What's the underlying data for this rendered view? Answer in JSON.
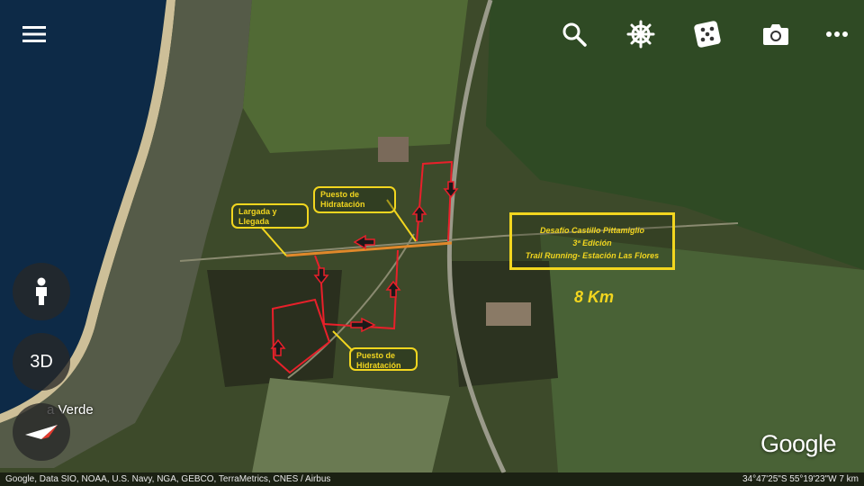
{
  "callouts": {
    "start": "Largada y Llegada",
    "hydration_top": "Puesto de Hidratación",
    "hydration_bottom": "Puesto de Hidratación"
  },
  "info": {
    "title": "Desafío Castillo Pittamiglio",
    "edition": "3ª Edición",
    "subtitle": "Trail Running- Estación Las Flores"
  },
  "distance": "8 Km",
  "town": "a Verde",
  "logo": "Google",
  "buttons": {
    "view_3d": "3D"
  },
  "footer": {
    "attribution": "Google, Data SIO, NOAA, U.S. Navy, NGA, GEBCO, TerraMetrics, CNES / Airbus",
    "coords": "34°47'25\"S 55°19'23\"W  7 km"
  },
  "colors": {
    "route": "#e8202a",
    "label": "#f2d61f",
    "road": "#e0882a"
  }
}
